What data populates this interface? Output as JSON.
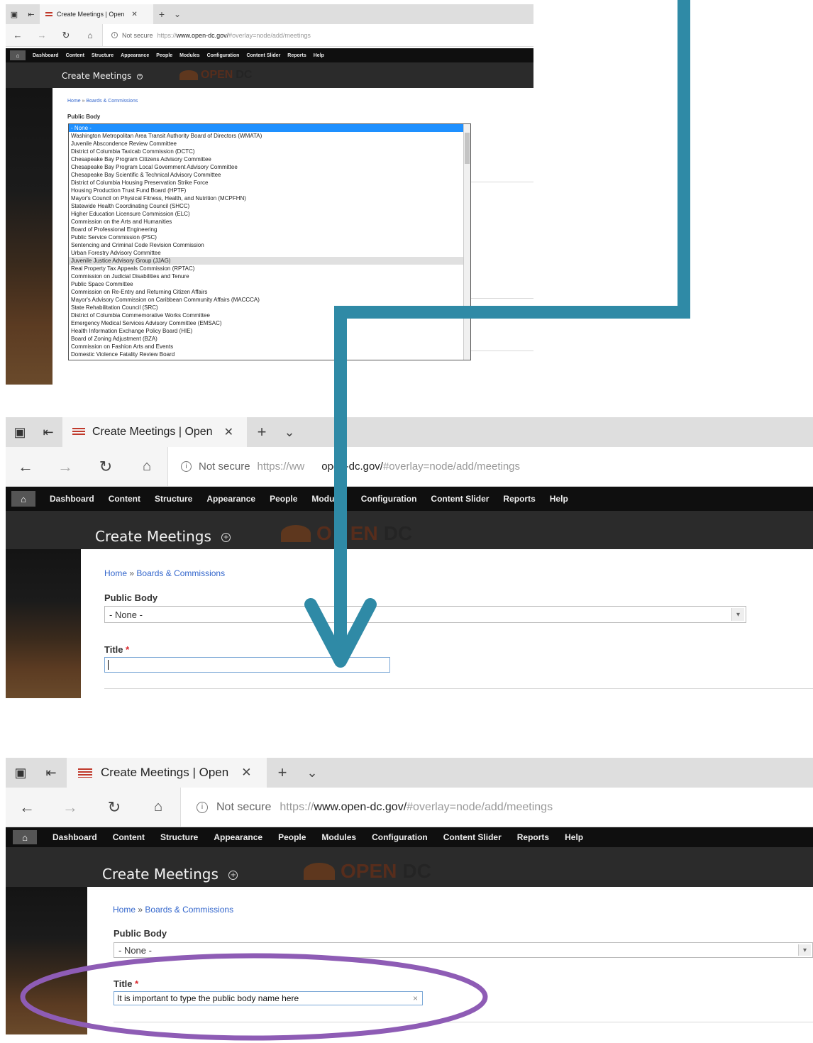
{
  "browser": {
    "tab_title": "Create Meetings | Open",
    "tab_close": "✕",
    "new_tab": "+",
    "tab_menu": "⌄",
    "not_secure": "Not secure",
    "url_short_host": "https://www.open-dc.gov/",
    "url_short_path": "#overlay=node/add/meetings",
    "url_mid_start": "https://ww",
    "url_mid_host": "open-dc.gov/",
    "url_mid_path": "#overlay=node/add/meetings",
    "url_full_scheme": "https://",
    "url_full_host": "www.open-dc.gov/",
    "url_full_path": "#overlay=node/add/meetings"
  },
  "toolbar": {
    "items": [
      "Dashboard",
      "Content",
      "Structure",
      "Appearance",
      "People",
      "Modules",
      "Configuration",
      "Content Slider",
      "Reports",
      "Help"
    ],
    "items_mid": [
      "Dashboard",
      "Content",
      "Structure",
      "Appearance",
      "People",
      "Modul",
      "Configuration",
      "Content Slider",
      "Reports",
      "Help"
    ]
  },
  "page": {
    "title": "Create Meetings",
    "logo_open": "OPEN",
    "logo_dc": "DC",
    "logo_open_mid_a": "O",
    "logo_open_mid_b": "EN"
  },
  "breadcrumb": {
    "home": "Home",
    "sep": "»",
    "section": "Boards & Commissions"
  },
  "form": {
    "public_body_label": "Public Body",
    "public_body_value": "- None -",
    "title_label": "Title",
    "required_mark": "*",
    "title_value": "It is important to type the public body name here",
    "clear": "×"
  },
  "dropdown_options": [
    "- None -",
    "Washington Metropolitan Area Transit Authority Board of Directors (WMATA)",
    "Juvenile Abscondence Review Committee",
    "District of Columbia Taxicab Commission (DCTC)",
    "Chesapeake Bay Program Citizens Advisory Committee",
    "Chesapeake Bay Program Local Government Advisory Committee",
    "Chesapeake Bay Scientific & Technical Advisory Committee",
    "District of Columbia Housing Preservation Strike Force",
    "Housing Production Trust Fund Board (HPTF)",
    "Mayor's Council on Physical Fitness, Health, and Nutrition (MCPFHN)",
    "Statewide Health Coordinating Council (SHCC)",
    "Higher Education Licensure Commission (ELC)",
    "Commission on the Arts and Humanities",
    "Board of Professional Engineering",
    "Public Service Commission (PSC)",
    "Sentencing and Criminal Code Revision Commission",
    "Urban Forestry Advisory Committee",
    "Juvenile Justice Advisory Group (JJAG)",
    "Real Property Tax Appeals Commission (RPTAC)",
    "Commission on Judicial Disabilities and Tenure",
    "Public Space Committee",
    "Commission on Re-Entry and Returning Citizen Affairs",
    "Mayor's Advisory Commission on Caribbean Community Affairs (MACCCA)",
    "State Rehabilitation Council (SRC)",
    "District of Columbia Commemorative Works Committee",
    "Emergency Medical Services Advisory Committee (EMSAC)",
    "Health Information Exchange Policy Board (HIE)",
    "Board of Zoning Adjustment (BZA)",
    "Commission on Fashion Arts and Events",
    "Domestic Violence Fatality Review Board"
  ],
  "dropdown_selected_index": 0,
  "dropdown_hover_index": 17,
  "colors": {
    "arrow": "#2f8aa6",
    "ellipse": "#8e5cb5",
    "link": "#3366cc",
    "required": "#d9262c",
    "selected_option": "#1e90ff"
  }
}
